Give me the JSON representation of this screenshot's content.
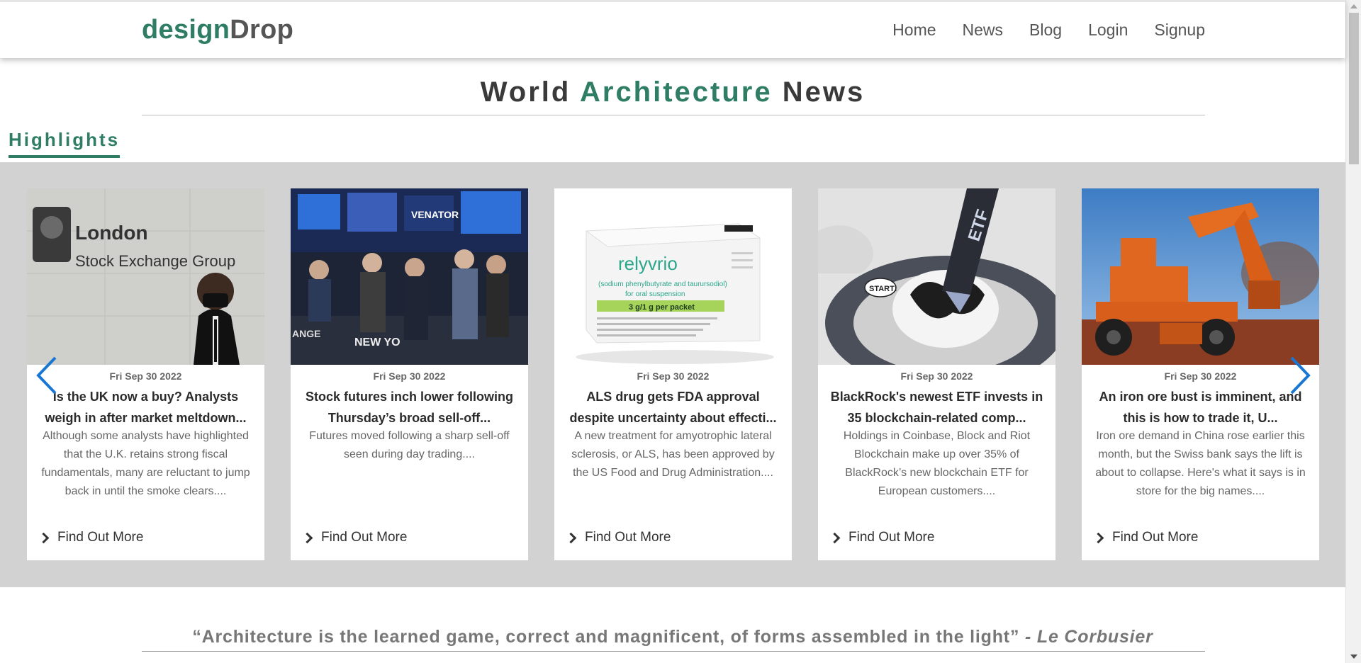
{
  "brand": {
    "part1": "design",
    "part2": "Drop"
  },
  "nav": [
    "Home",
    "News",
    "Blog",
    "Login",
    "Signup"
  ],
  "title": {
    "pre": "World ",
    "accent": "Architecture",
    "post": " News"
  },
  "section_label": "Highlights",
  "cards": [
    {
      "date": "Fri Sep 30 2022",
      "headline": "Is the UK now a buy? Analysts weigh in after market meltdown...",
      "summary": "Although some analysts have highlighted that the U.K. retains strong fiscal fundamentals, many are reluctant to jump back in until the smoke clears....",
      "link": "Find Out More",
      "image_text": [
        "London",
        "Stock Exchange Group"
      ]
    },
    {
      "date": "Fri Sep 30 2022",
      "headline": "Stock futures inch lower following Thursday’s broad sell-off...",
      "summary": "Futures moved following a sharp sell-off seen during day trading....",
      "link": "Find Out More",
      "image_text": [
        "VENATOR",
        "NEW YO",
        "ANGE"
      ]
    },
    {
      "date": "Fri Sep 30 2022",
      "headline": "ALS drug gets FDA approval despite uncertainty about effecti...",
      "summary": "A new treatment for amyotrophic lateral sclerosis, or ALS, has been approved by the US Food and Drug Administration....",
      "link": "Find Out More",
      "image_text": [
        "relyvrio",
        "(sodium phenylbutyrate and taurursodiol)",
        "for oral suspension",
        "3 g/1 g per packet"
      ]
    },
    {
      "date": "Fri Sep 30 2022",
      "headline": "BlackRock's newest ETF invests in 35 blockchain-related comp...",
      "summary": "Holdings in Coinbase, Block and Riot Blockchain make up over 35% of BlackRock’s new blockchain ETF for European customers....",
      "link": "Find Out More",
      "image_text": [
        "ETF",
        "START!"
      ]
    },
    {
      "date": "Fri Sep 30 2022",
      "headline": "An iron ore bust is imminent, and this is how to trade it, U...",
      "summary": "Iron ore demand in China rose earlier this month, but the Swiss bank says the lift is about to collapse. Here's what it says is in store for the big names....",
      "link": "Find Out More",
      "image_text": []
    }
  ],
  "quote": {
    "text": "“Architecture is the learned game, correct and magnificent, of forms assembled in the light”",
    "author": " - Le Corbusier"
  },
  "colors": {
    "accent": "#2e7d64",
    "carousel_bg": "#d2d2d2",
    "arrow": "#1976d2"
  }
}
